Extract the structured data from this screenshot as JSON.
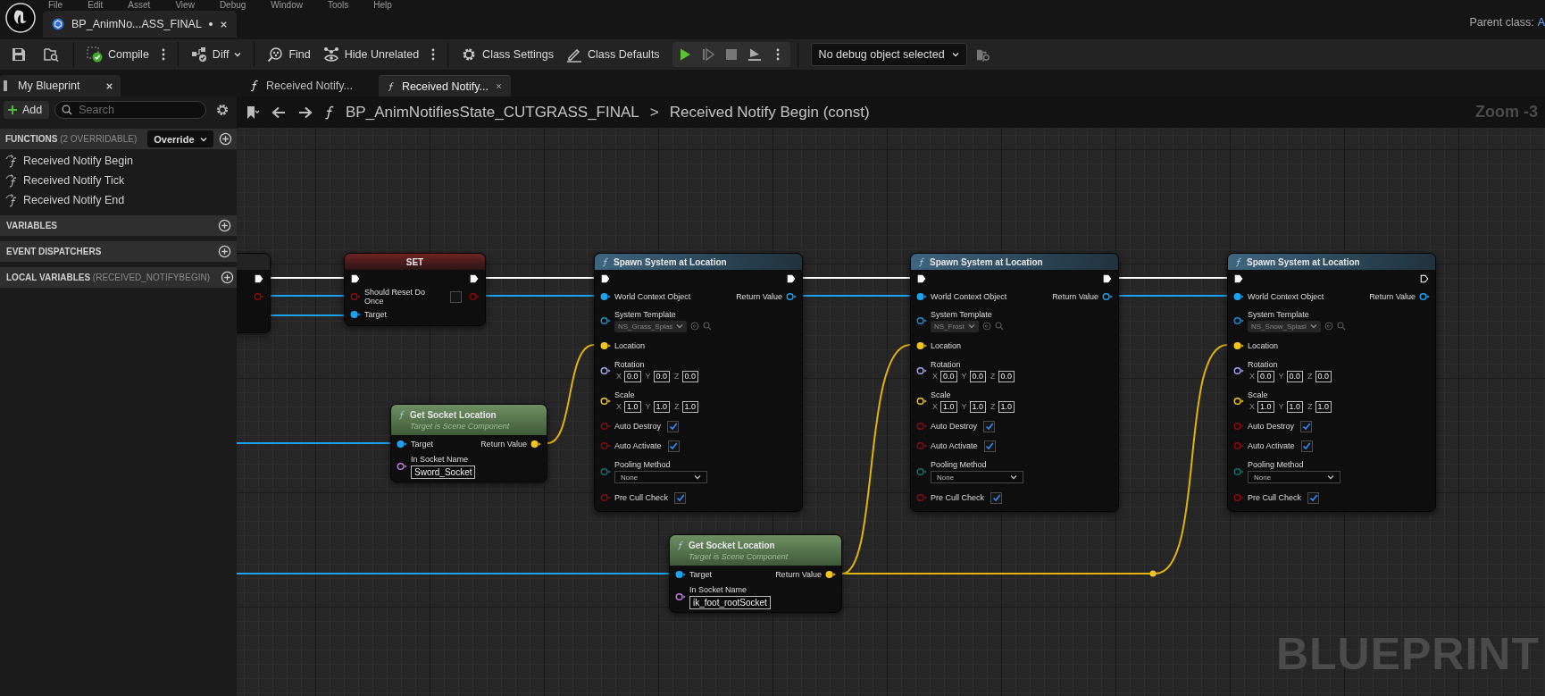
{
  "menu": [
    "File",
    "Edit",
    "Asset",
    "View",
    "Debug",
    "Window",
    "Tools",
    "Help"
  ],
  "document_tab": {
    "title": "BP_AnimNo...ASS_FINAL",
    "unsaved": true
  },
  "parent_class": {
    "label": "Parent class:",
    "value": "A"
  },
  "toolbar": {
    "compile": "Compile",
    "diff": "Diff",
    "find": "Find",
    "hide_unrelated": "Hide Unrelated",
    "class_settings": "Class Settings",
    "class_defaults": "Class Defaults",
    "debug_object": "No debug object selected"
  },
  "panel_tab": {
    "title": "My Blueprint"
  },
  "graph_tabs": [
    {
      "label": "Received Notify...",
      "selected": false
    },
    {
      "label": "Received Notify...",
      "selected": true
    }
  ],
  "my_blueprint": {
    "add_label": "Add",
    "search": {
      "placeholder": "Search"
    },
    "sections": [
      {
        "title": "FUNCTIONS",
        "note": "(2 OVERRIDABLE)",
        "override": "Override",
        "expanded": true,
        "items": [
          "Received Notify Begin",
          "Received Notify Tick",
          "Received Notify End"
        ]
      },
      {
        "title": "VARIABLES",
        "expanded": false
      },
      {
        "title": "EVENT DISPATCHERS",
        "expanded": false
      },
      {
        "title": "LOCAL VARIABLES",
        "note": "(RECEIVED_NOTIFYBEGIN)",
        "expanded": false
      }
    ]
  },
  "breadcrumb": {
    "blueprint": "BP_AnimNotifiesState_CUTGRASS_FINAL",
    "separator": ">",
    "function": "Received Notify Begin (const)"
  },
  "zoom": "Zoom -3",
  "graph_label": "BLUEPRINT",
  "nodes": [
    {
      "kind": "partial"
    },
    {
      "kind": "set",
      "title": "SET",
      "bool_label": "Should Reset Do Once",
      "checked": false,
      "target_label": "Target"
    },
    {
      "kind": "spawn",
      "title": "Spawn System at Location",
      "then_connected": true,
      "world_context": "World Context Object",
      "return_value": "Return Value",
      "system_template": {
        "label": "System Template",
        "value": "NS_Grass_Splas"
      },
      "location": "Location",
      "rotation": {
        "label": "Rotation",
        "components": [
          {
            "axis": "X",
            "value": "0.0"
          },
          {
            "axis": "Y",
            "value": "0.0"
          },
          {
            "axis": "Z",
            "value": "0.0"
          }
        ]
      },
      "scale": {
        "label": "Scale",
        "components": [
          {
            "axis": "X",
            "value": "1.0"
          },
          {
            "axis": "Y",
            "value": "1.0"
          },
          {
            "axis": "Z",
            "value": "1.0"
          }
        ]
      },
      "auto_destroy": {
        "label": "Auto Destroy",
        "checked": true
      },
      "auto_activate": {
        "label": "Auto Activate",
        "checked": true
      },
      "pooling_method": {
        "label": "Pooling Method",
        "value": "None"
      },
      "pre_cull_check": {
        "label": "Pre Cull Check",
        "checked": true
      }
    },
    {
      "kind": "spawn",
      "title": "Spawn System at Location",
      "then_connected": true,
      "world_context": "World Context Object",
      "return_value": "Return Value",
      "system_template": {
        "label": "System Template",
        "value": "NS_Frost"
      },
      "location": "Location",
      "rotation": {
        "label": "Rotation",
        "components": [
          {
            "axis": "X",
            "value": "0.0"
          },
          {
            "axis": "Y",
            "value": "0.0"
          },
          {
            "axis": "Z",
            "value": "0.0"
          }
        ]
      },
      "scale": {
        "label": "Scale",
        "components": [
          {
            "axis": "X",
            "value": "1.0"
          },
          {
            "axis": "Y",
            "value": "1.0"
          },
          {
            "axis": "Z",
            "value": "1.0"
          }
        ]
      },
      "auto_destroy": {
        "label": "Auto Destroy",
        "checked": true
      },
      "auto_activate": {
        "label": "Auto Activate",
        "checked": true
      },
      "pooling_method": {
        "label": "Pooling Method",
        "value": "None"
      },
      "pre_cull_check": {
        "label": "Pre Cull Check",
        "checked": true
      }
    },
    {
      "kind": "spawn",
      "title": "Spawn System at Location",
      "then_connected": false,
      "world_context": "World Context Object",
      "return_value": "Return Value",
      "system_template": {
        "label": "System Template",
        "value": "NS_Snow_Splasl"
      },
      "location": "Location",
      "rotation": {
        "label": "Rotation",
        "components": [
          {
            "axis": "X",
            "value": "0.0"
          },
          {
            "axis": "Y",
            "value": "0.0"
          },
          {
            "axis": "Z",
            "value": "0.0"
          }
        ]
      },
      "scale": {
        "label": "Scale",
        "components": [
          {
            "axis": "X",
            "value": "1.0"
          },
          {
            "axis": "Y",
            "value": "1.0"
          },
          {
            "axis": "Z",
            "value": "1.0"
          }
        ]
      },
      "auto_destroy": {
        "label": "Auto Destroy",
        "checked": true
      },
      "auto_activate": {
        "label": "Auto Activate",
        "checked": true
      },
      "pooling_method": {
        "label": "Pooling Method",
        "value": "None"
      },
      "pre_cull_check": {
        "label": "Pre Cull Check",
        "checked": true
      }
    },
    {
      "kind": "get_socket",
      "title": "Get Socket Location",
      "subtitle": "Target is Scene Component",
      "target": "Target",
      "return_value": "Return Value",
      "socket_label": "In Socket Name",
      "socket_value": "Sword_Socket"
    },
    {
      "kind": "get_socket",
      "title": "Get Socket Location",
      "subtitle": "Target is Scene Component",
      "target": "Target",
      "return_value": "Return Value",
      "socket_label": "In Socket Name",
      "socket_value": "ik_foot_rootSocket"
    }
  ]
}
